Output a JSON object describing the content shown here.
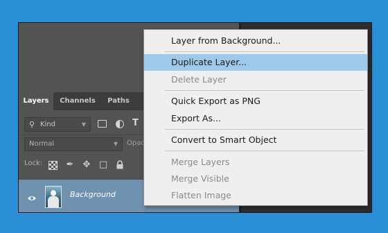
{
  "colors": {
    "background": "#2b8fd6",
    "panel": "#535353",
    "selected_layer": "#6f92b0",
    "menu_bg": "#efefef",
    "menu_highlight": "#9ec9e8"
  },
  "layers_panel": {
    "tabs": [
      {
        "label": "Layers",
        "active": true
      },
      {
        "label": "Channels",
        "active": false
      },
      {
        "label": "Paths",
        "active": false
      }
    ],
    "filter": {
      "kind_label": "Kind",
      "icons": [
        "search-icon",
        "image-filter-icon",
        "adjustment-filter-icon",
        "type-filter-icon"
      ]
    },
    "blend_mode": "Normal",
    "opacity_label": "Opac",
    "lock_label": "Lock:",
    "lock_icons": [
      "lock-transparent-icon",
      "lock-paint-icon",
      "lock-position-icon",
      "lock-artboard-icon",
      "lock-all-icon"
    ],
    "layers": [
      {
        "name": "Background",
        "visible": true,
        "selected": true
      }
    ]
  },
  "context_menu": {
    "items": [
      {
        "label": "Layer from Background...",
        "enabled": true,
        "highlighted": false
      },
      {
        "label": "Duplicate Layer...",
        "enabled": true,
        "highlighted": true
      },
      {
        "label": "Delete Layer",
        "enabled": false,
        "highlighted": false
      },
      {
        "label": "Quick Export as PNG",
        "enabled": true,
        "highlighted": false
      },
      {
        "label": "Export As...",
        "enabled": true,
        "highlighted": false
      },
      {
        "label": "Convert to Smart Object",
        "enabled": true,
        "highlighted": false
      },
      {
        "label": "Merge Layers",
        "enabled": false,
        "highlighted": false
      },
      {
        "label": "Merge Visible",
        "enabled": false,
        "highlighted": false
      },
      {
        "label": "Flatten Image",
        "enabled": false,
        "highlighted": false
      }
    ]
  }
}
